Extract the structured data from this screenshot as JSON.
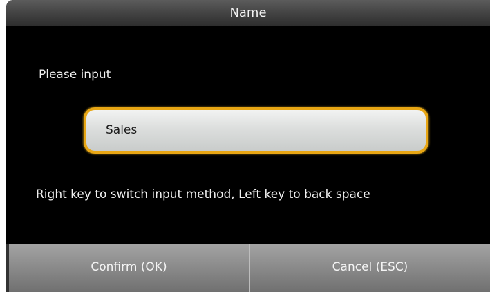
{
  "header": {
    "title": "Name"
  },
  "form": {
    "prompt_label": "Please input",
    "input_value": "Sales",
    "hint": "Right key to switch input method, Left key to back space"
  },
  "buttons": {
    "confirm_label": "Confirm (OK)",
    "cancel_label": "Cancel (ESC)"
  },
  "colors": {
    "background": "#000000",
    "input_border": "#e8a614",
    "button_gray": "#8c8c8c"
  }
}
